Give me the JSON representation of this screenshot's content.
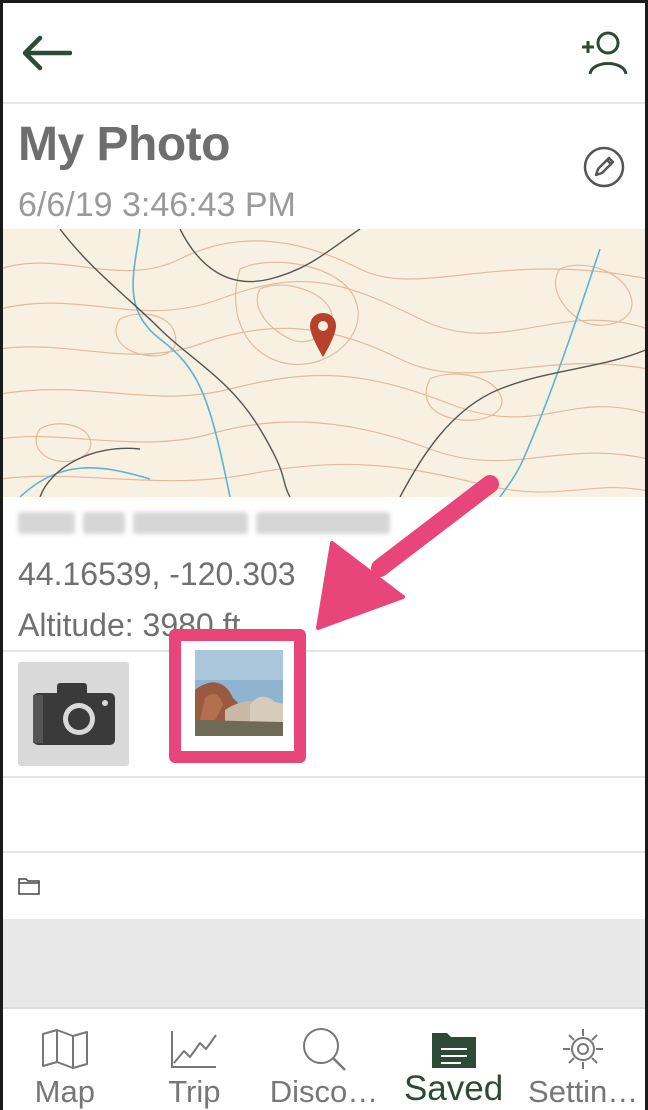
{
  "header": {
    "back_icon": "arrow-left-icon",
    "add_user_icon": "add-user-icon",
    "accent_color": "#2c4a35"
  },
  "photo": {
    "title": "My Photo",
    "datetime": "6/6/19 3:46:43 PM",
    "edit_icon": "pencil-icon"
  },
  "map": {
    "marker_icon": "map-pin-icon",
    "marker_color": "#b7412a"
  },
  "location": {
    "coordinates": "44.16539, -120.303",
    "altitude": "Altitude: 3980 ft"
  },
  "media": {
    "camera_icon": "camera-icon",
    "highlight_color": "#e8457a"
  },
  "folder": {
    "icon": "folder-icon"
  },
  "nav": {
    "items": [
      {
        "label": "Map",
        "icon": "map-icon"
      },
      {
        "label": "Trip",
        "icon": "chart-line-icon"
      },
      {
        "label": "Disco…",
        "icon": "search-icon"
      },
      {
        "label": "Saved",
        "icon": "saved-folder-icon",
        "active": true
      },
      {
        "label": "Settin…",
        "icon": "gear-icon"
      }
    ]
  }
}
